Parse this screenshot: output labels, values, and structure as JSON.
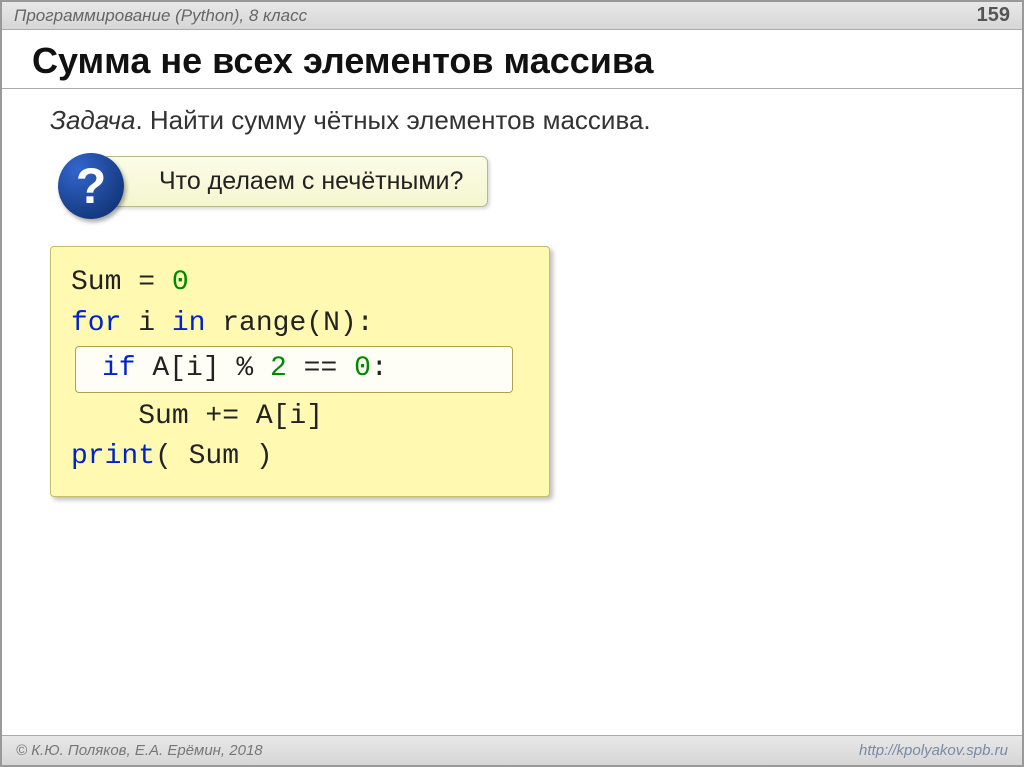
{
  "header": {
    "course": "Программирование (Python), 8 класс",
    "page": "159"
  },
  "title": "Сумма не всех элементов массива",
  "task": {
    "label": "Задача",
    "text": ". Найти сумму чётных элементов массива."
  },
  "hint": {
    "mark": "?",
    "text": "Что делаем с нечётными?"
  },
  "code": {
    "l1a": "Sum = ",
    "l1b": "0",
    "l2a": "for",
    "l2b": " i ",
    "l2c": "in",
    "l2d": " range",
    "l2e": "(N):",
    "l3a": "if",
    "l3b": " A[i] % ",
    "l3c": "2",
    "l3d": " == ",
    "l3e": "0",
    "l3f": ":",
    "l4": "    Sum += A[i]",
    "l5a": "print",
    "l5b": "( Sum )"
  },
  "footer": {
    "left": "© К.Ю. Поляков, Е.А. Ерёмин, 2018",
    "right": "http://kpolyakov.spb.ru"
  }
}
